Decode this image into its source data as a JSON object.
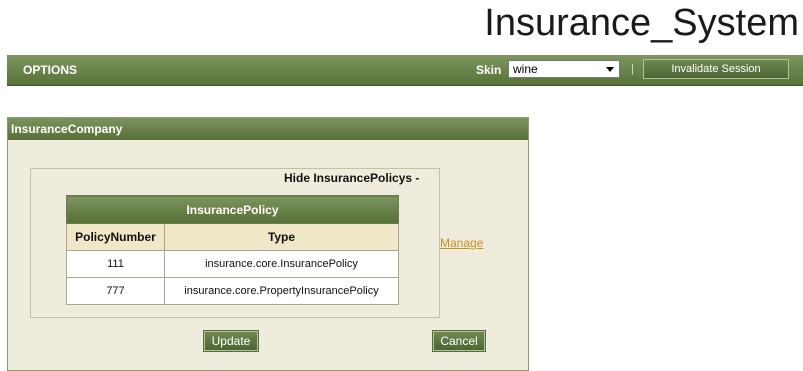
{
  "app": {
    "title": "Insurance_System"
  },
  "topbar": {
    "options_label": "OPTIONS",
    "skin_label": "Skin",
    "skin_value": "wine",
    "separator": "|",
    "invalidate_label": "Invalidate Session"
  },
  "panel": {
    "title": "InsuranceCompany",
    "hide_label": "Hide InsurancePolicys -",
    "manage_label": "Manage",
    "update_label": "Update",
    "cancel_label": "Cancel",
    "table": {
      "title": "InsurancePolicy",
      "headers": [
        "PolicyNumber",
        "Type"
      ],
      "rows": [
        [
          "111",
          "insurance.core.InsurancePolicy"
        ],
        [
          "777",
          "insurance.core.PropertyInsurancePolicy"
        ]
      ]
    }
  },
  "colors": {
    "accent": "#6a8448",
    "panel_bg": "#efebdd",
    "link": "#c8901c"
  }
}
